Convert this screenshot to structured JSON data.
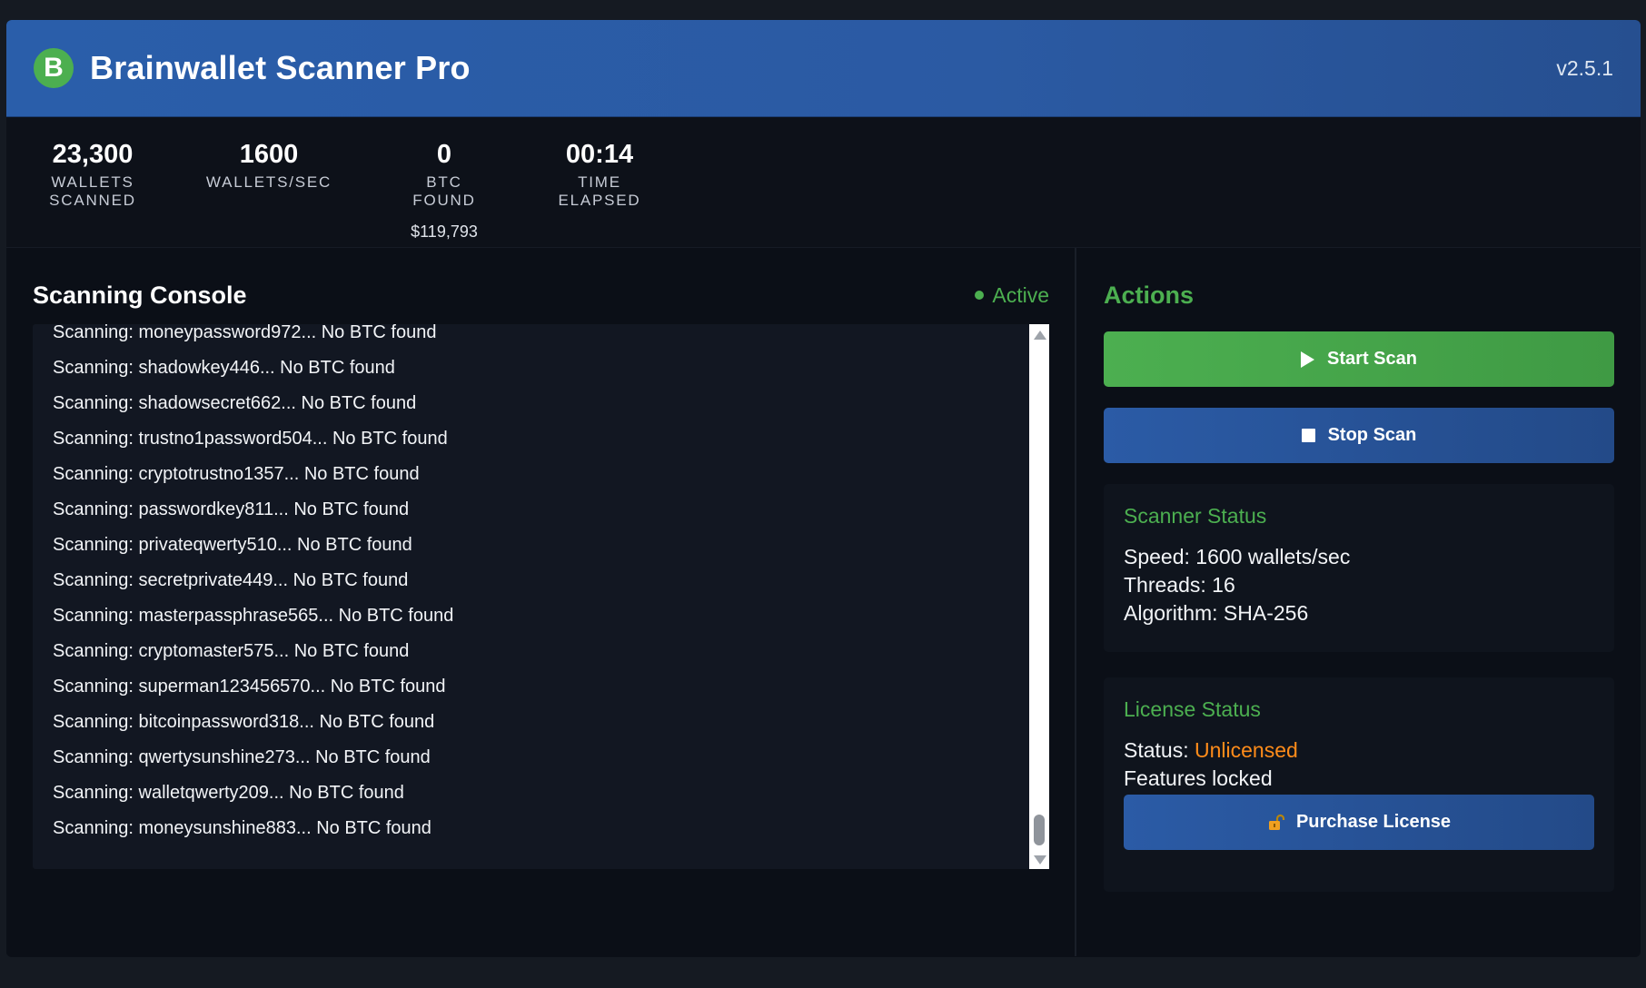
{
  "header": {
    "logo_letter": "B",
    "title": "Brainwallet Scanner Pro",
    "version": "v2.5.1"
  },
  "stats": [
    {
      "value": "23,300",
      "label": "WALLETS SCANNED",
      "sub": ""
    },
    {
      "value": "1600",
      "label": "WALLETS/SEC",
      "sub": ""
    },
    {
      "value": "0",
      "label": "BTC FOUND",
      "sub": "$119,793"
    },
    {
      "value": "00:14",
      "label": "TIME ELAPSED",
      "sub": ""
    }
  ],
  "console": {
    "title": "Scanning Console",
    "status": "Active",
    "lines": [
      "Scanning: moneypassword972... No BTC found",
      "Scanning: shadowkey446... No BTC found",
      "Scanning: shadowsecret662... No BTC found",
      "Scanning: trustno1password504... No BTC found",
      "Scanning: cryptotrustno1357... No BTC found",
      "Scanning: passwordkey811... No BTC found",
      "Scanning: privateqwerty510... No BTC found",
      "Scanning: secretprivate449... No BTC found",
      "Scanning: masterpassphrase565... No BTC found",
      "Scanning: cryptomaster575... No BTC found",
      "Scanning: superman123456570... No BTC found",
      "Scanning: bitcoinpassword318... No BTC found",
      "Scanning: qwertysunshine273... No BTC found",
      "Scanning: walletqwerty209... No BTC found",
      "Scanning: moneysunshine883... No BTC found"
    ]
  },
  "actions": {
    "title": "Actions",
    "start_label": "Start Scan",
    "stop_label": "Stop Scan"
  },
  "scanner_status": {
    "title": "Scanner Status",
    "speed": "Speed: 1600 wallets/sec",
    "threads": "Threads: 16",
    "algorithm": "Algorithm: SHA-256"
  },
  "license_status": {
    "title": "License Status",
    "status_prefix": "Status: ",
    "status_value": "Unlicensed",
    "features": "Features locked",
    "purchase_label": "Purchase License"
  },
  "colors": {
    "accent_green": "#4caf50",
    "header_blue": "#2a5eaa",
    "warning_orange": "#ff8c1a"
  },
  "icons": {
    "play": "play-icon",
    "stop": "stop-icon",
    "lock": "unlock-icon"
  }
}
